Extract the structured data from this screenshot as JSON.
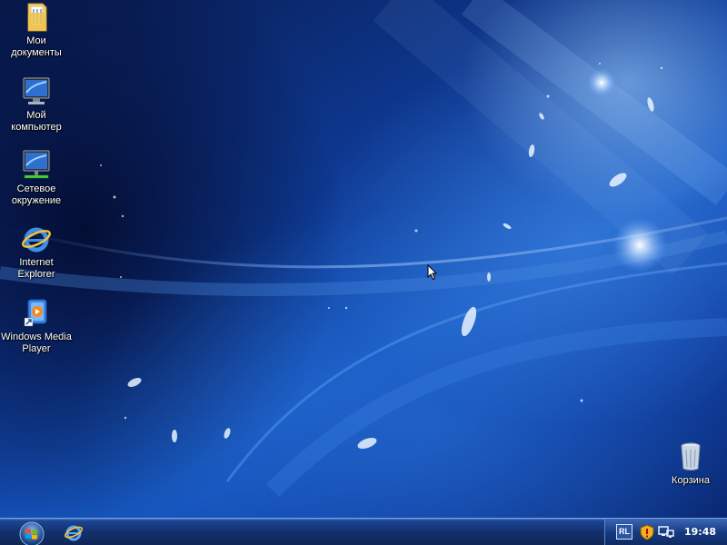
{
  "desktop": {
    "icons": [
      {
        "label": "Мои\nдокументы",
        "icon": "my-documents-folder-icon"
      },
      {
        "label": "Мой\nкомпьютер",
        "icon": "my-computer-icon"
      },
      {
        "label": "Сетевое\nокружение",
        "icon": "network-places-icon"
      },
      {
        "label": "Internet\nExplorer",
        "icon": "internet-explorer-icon"
      },
      {
        "label": "Windows Media\nPlayer",
        "icon": "windows-media-player-icon"
      },
      {
        "label": "Корзина",
        "icon": "recycle-bin-icon"
      }
    ]
  },
  "taskbar": {
    "start_icon": "windows-orb-icon",
    "quick_launch": [
      "internet-explorer-icon"
    ],
    "tray": {
      "language": "RL",
      "security_icon": "security-shield-icon",
      "network_icon": "network-status-icon",
      "clock": "19:48"
    }
  },
  "colors": {
    "wallpaper_accent": "#1658c2",
    "taskbar": "#14306e",
    "label_text": "#ffffff"
  }
}
